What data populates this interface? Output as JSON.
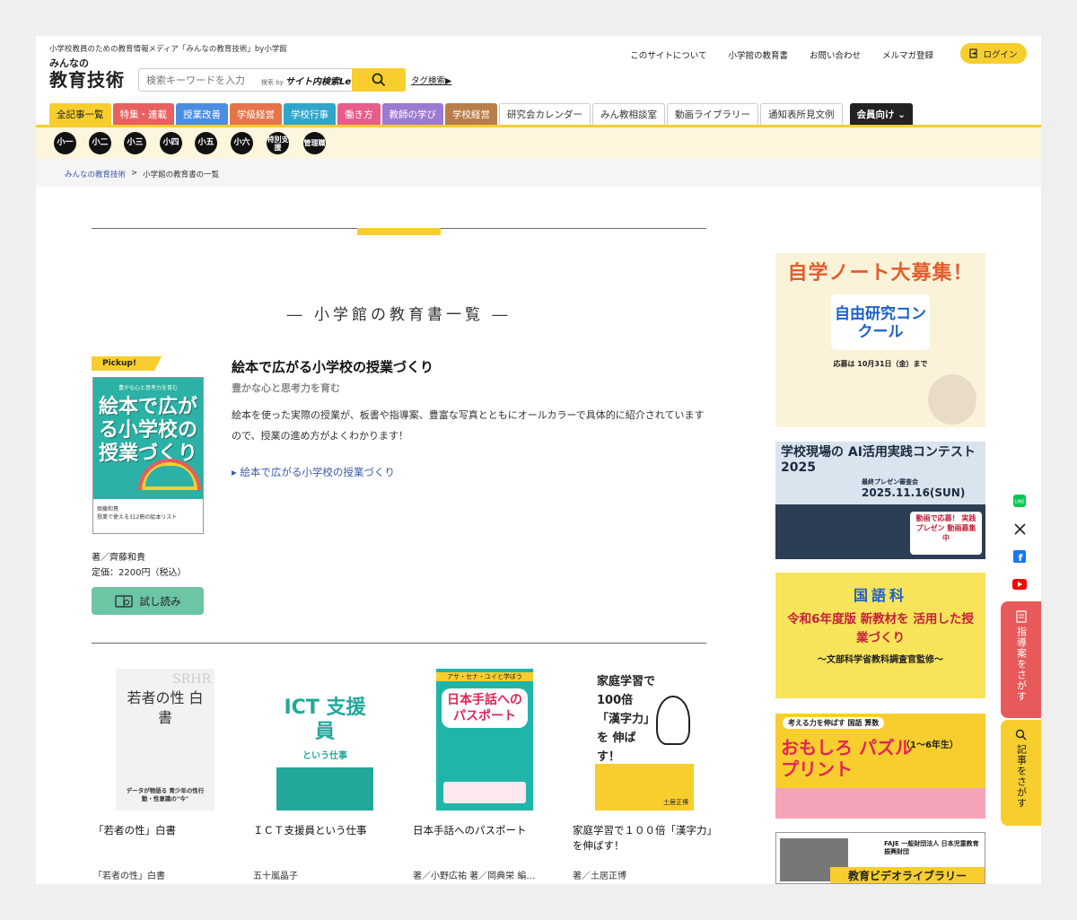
{
  "header": {
    "tagline": "小学校教員のための教育情報メディア「みんなの教育技術」by小学館",
    "logo_small": "みんなの",
    "logo_big": "教育技術",
    "search_placeholder": "検索キーワードを入力",
    "search_by": "検索 by",
    "search_by_site": "サイト内検索Let's",
    "tag_search": "タグ検索▶",
    "top_links": [
      "このサイトについて",
      "小学館の教育書",
      "お問い合わせ",
      "メルマガ登録"
    ],
    "login_label": "ログイン"
  },
  "nav": {
    "items": [
      {
        "label": "全記事一覧",
        "color": "#f7ce2e",
        "text": "#222"
      },
      {
        "label": "特集・連載",
        "color": "#e96060",
        "text": "#fff"
      },
      {
        "label": "授業改善",
        "color": "#4b8de0",
        "text": "#fff"
      },
      {
        "label": "学級経営",
        "color": "#e5744b",
        "text": "#fff"
      },
      {
        "label": "学校行事",
        "color": "#2fa6c9",
        "text": "#fff"
      },
      {
        "label": "働き方",
        "color": "#e65d8a",
        "text": "#fff"
      },
      {
        "label": "教師の学び",
        "color": "#9b7ad1",
        "text": "#fff"
      },
      {
        "label": "学校経営",
        "color": "#b87d48",
        "text": "#fff"
      }
    ],
    "light_items": [
      "研究会カレンダー",
      "みん教相談室",
      "動画ライブラリー",
      "通知表所見文例"
    ],
    "member": "会員向け ⌄",
    "grades": [
      "小一",
      "小二",
      "小三",
      "小四",
      "小五",
      "小六",
      "特別支援",
      "管理職"
    ]
  },
  "breadcrumb": {
    "home": "みんなの教育技術",
    "sep": ">",
    "current": "小学館の教育書の一覧"
  },
  "main": {
    "section_title": "― 小学館の教育書一覧 ―",
    "pickup_label": "Pickup!",
    "feature": {
      "cover_top": "豊かな心と思考力を育む",
      "cover_title": "絵本で広がる小学校の授業づくり",
      "cover_author": "齊藤和貴",
      "cover_bottom": "授業で使える312冊の絵本リスト",
      "title": "絵本で広がる小学校の授業づくり",
      "subtitle": "豊かな心と思考力を育む",
      "description": "絵本を使った実際の授業が、板書や指導案、豊富な写真とともにオールカラーで具体的に紹介されていますので、授業の進め方がよくわかります！",
      "link": "▸ 絵本で広がる小学校の授業づくり",
      "author": "著／齊藤和貴",
      "price": "定価：2200円（税込）",
      "trial_label": "試し読み"
    },
    "books": [
      {
        "title": "「若者の性」白書",
        "author": "「若者の性」白書",
        "cover_text": "若者の性 白書",
        "cover_sub": "データが物語る 青少年の性行動・性意識の\"今\""
      },
      {
        "title": "ＩＣＴ支援員という仕事",
        "author": "五十嵐晶子",
        "cover_text": "ICT 支援員",
        "cover_sub": "という仕事"
      },
      {
        "title": "日本手話へのパスポート",
        "author": "著／小野広祐 著／岡典栄 編…",
        "cover_text": "日本手話への パスポート",
        "cover_sub": "アサ・セナ・ユイと学ぼう"
      },
      {
        "title": "家庭学習で１００倍「漢字力」を伸ばす！",
        "author": "著／土居正博",
        "cover_text": "家庭学習で 100倍 「漢字力」を 伸ばす！",
        "cover_sub": "土居正博"
      }
    ]
  },
  "sidebar": {
    "ad1_title": "自学ノート大募集！",
    "ad1_sub": "自由研究コンクール",
    "ad1_date": "応募は 10月31日（金）まで",
    "ad2_title": "学校現場の AI活用実践コンテスト2025",
    "ad2_sub": "最終プレゼン審査会",
    "ad2_date": "2025.11.16(SUN)",
    "ad2_cta": "動画で応募！ 実践プレゼン 動画募集中",
    "ad3_subject": "国語科",
    "ad3_title": "令和6年度版 新教材を 活用した授業づくり",
    "ad3_sub": "〜文部科学省教科調査官監修〜",
    "ad4_top": "考える力を伸ばす 国語 算数",
    "ad4_title": "おもしろ パズルプリント",
    "ad4_grades": "（1〜6年生）",
    "ad5_org": "FAJE 一般財団法人 日本児童教育振興財団",
    "ad5_title": "教育ビデオライブラリー",
    "tab1": "指導案をさがす",
    "tab2": "記事をさがす"
  }
}
